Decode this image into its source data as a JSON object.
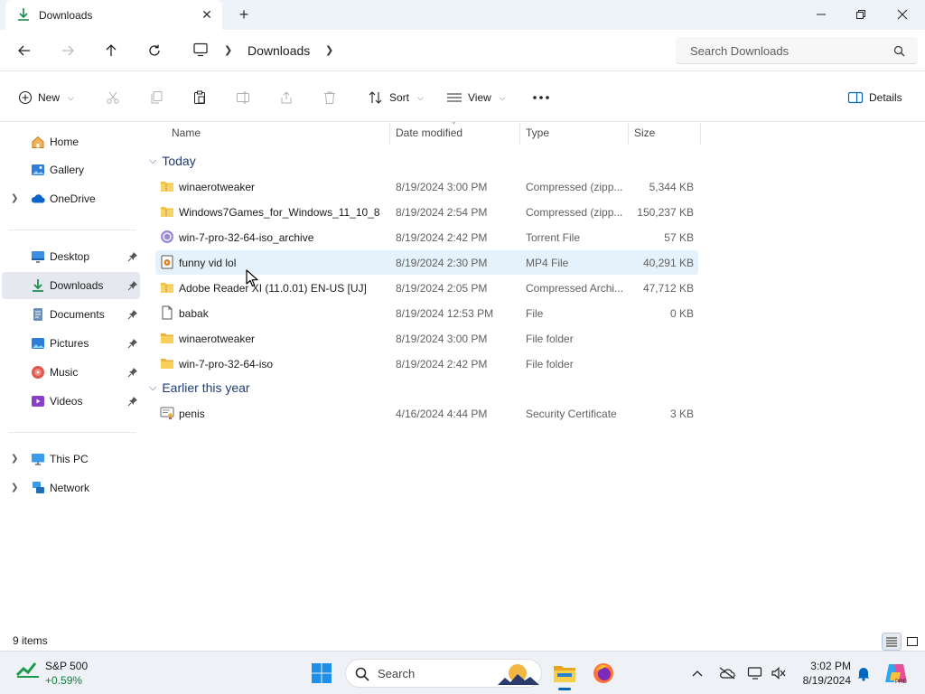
{
  "window": {
    "tab_title": "Downloads",
    "minimize_label": "Minimize",
    "maximize_label": "Maximize",
    "close_label": "Close"
  },
  "address": {
    "location": "Downloads",
    "search_placeholder": "Search Downloads"
  },
  "command_bar": {
    "new_label": "New",
    "sort_label": "Sort",
    "view_label": "View",
    "details_label": "Details"
  },
  "sidebar": {
    "top_items": [
      {
        "label": "Home",
        "icon": "home-icon"
      },
      {
        "label": "Gallery",
        "icon": "gallery-icon"
      },
      {
        "label": "OneDrive",
        "icon": "onedrive-icon"
      }
    ],
    "quick_access": [
      {
        "label": "Desktop",
        "icon": "desktop-icon",
        "pinned": true
      },
      {
        "label": "Downloads",
        "icon": "downloads-icon",
        "pinned": true,
        "selected": true
      },
      {
        "label": "Documents",
        "icon": "documents-icon",
        "pinned": true
      },
      {
        "label": "Pictures",
        "icon": "pictures-icon",
        "pinned": true
      },
      {
        "label": "Music",
        "icon": "music-icon",
        "pinned": true
      },
      {
        "label": "Videos",
        "icon": "videos-icon",
        "pinned": true
      }
    ],
    "bottom_items": [
      {
        "label": "This PC",
        "icon": "this-pc-icon"
      },
      {
        "label": "Network",
        "icon": "network-icon"
      }
    ]
  },
  "columns": {
    "name": "Name",
    "date": "Date modified",
    "type": "Type",
    "size": "Size"
  },
  "groups": [
    {
      "label": "Today",
      "files": [
        {
          "name": "winaerotweaker",
          "date": "8/19/2024 3:00 PM",
          "type": "Compressed (zipp...",
          "size": "5,344 KB",
          "icon": "zip-folder-icon"
        },
        {
          "name": "Windows7Games_for_Windows_11_10_8",
          "date": "8/19/2024 2:54 PM",
          "type": "Compressed (zipp...",
          "size": "150,237 KB",
          "icon": "zip-folder-icon"
        },
        {
          "name": "win-7-pro-32-64-iso_archive",
          "date": "8/19/2024 2:42 PM",
          "type": "Torrent File",
          "size": "57 KB",
          "icon": "torrent-icon"
        },
        {
          "name": "funny vid lol",
          "date": "8/19/2024 2:30 PM",
          "type": "MP4 File",
          "size": "40,291 KB",
          "icon": "video-file-icon",
          "hover": true
        },
        {
          "name": "Adobe Reader XI (11.0.01) EN-US [UJ]",
          "date": "8/19/2024 2:05 PM",
          "type": "Compressed Archi...",
          "size": "47,712 KB",
          "icon": "zip-folder-icon"
        },
        {
          "name": "babak",
          "date": "8/19/2024 12:53 PM",
          "type": "File",
          "size": "0 KB",
          "icon": "file-icon"
        },
        {
          "name": "winaerotweaker",
          "date": "8/19/2024 3:00 PM",
          "type": "File folder",
          "size": "",
          "icon": "folder-icon"
        },
        {
          "name": "win-7-pro-32-64-iso",
          "date": "8/19/2024 2:42 PM",
          "type": "File folder",
          "size": "",
          "icon": "folder-icon"
        }
      ]
    },
    {
      "label": "Earlier this year",
      "files": [
        {
          "name": "penis",
          "date": "4/16/2024 4:44 PM",
          "type": "Security Certificate",
          "size": "3 KB",
          "icon": "certificate-icon"
        }
      ]
    }
  ],
  "status": {
    "item_count": "9 items"
  },
  "taskbar": {
    "stock_name": "S&P 500",
    "stock_change": "+0.59%",
    "search_label": "Search",
    "time": "3:02 PM",
    "date": "8/19/2024"
  },
  "colors": {
    "accent": "#0067c0",
    "folder": "#f4c542",
    "group_text": "#1e3d76",
    "selection": "#e5f1fb",
    "stock_up": "#107c41"
  }
}
